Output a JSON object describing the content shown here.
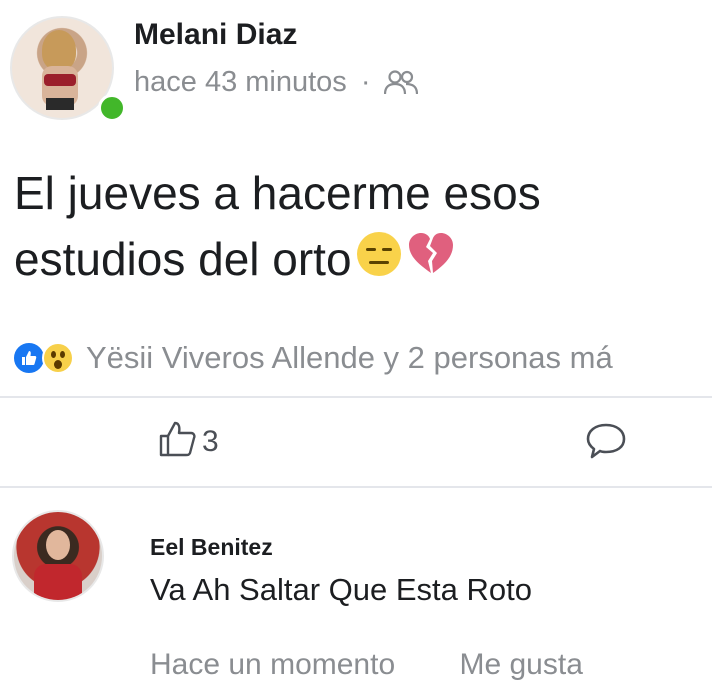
{
  "post": {
    "author": "Melani Diaz",
    "time": "hace 43 minutos",
    "separator": "·",
    "text": "El jueves a hacerme esos estudios del orto",
    "reactions_text": "Yësii Viveros Allende y 2 personas má",
    "like_count": "3"
  },
  "comment": {
    "author": "Eel Benitez",
    "text": "Va Ah Saltar Que Esta Roto",
    "actions": [
      "Hace un momento",
      "Me gusta"
    ]
  },
  "colors": {
    "online": "#42b72a",
    "like_blue": "#1877f2",
    "muted_text": "#8a8d91"
  },
  "icons": [
    "friends-icon",
    "expressionless-emoji",
    "broken-heart-emoji",
    "like-reaction-icon",
    "wow-reaction-icon",
    "thumbs-up-icon",
    "comment-icon"
  ]
}
